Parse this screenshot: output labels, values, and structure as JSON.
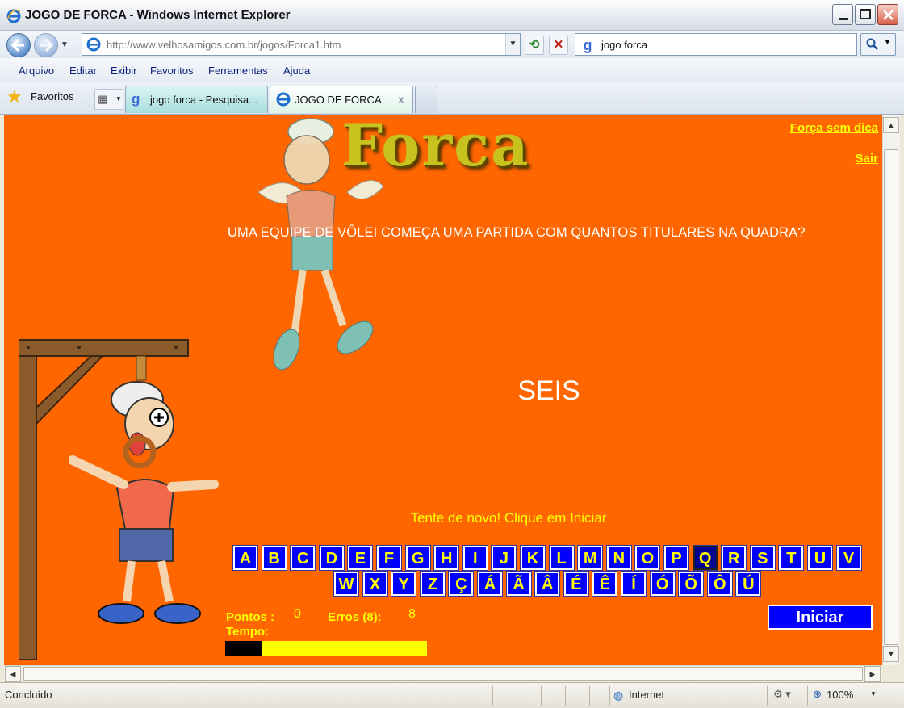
{
  "window": {
    "title": "JOGO DE FORCA - Windows Internet Explorer"
  },
  "address": {
    "url": "http://www.velhosamigos.com.br/jogos/Forca1.htm"
  },
  "search": {
    "value": "jogo forca"
  },
  "menu": {
    "items": [
      "Arquivo",
      "Editar",
      "Exibir",
      "Favoritos",
      "Ferramentas",
      "Ajuda"
    ]
  },
  "favorites": {
    "label": "Favoritos"
  },
  "tabs": [
    {
      "label": "jogo forca - Pesquisa...",
      "active": false
    },
    {
      "label": "JOGO DE FORCA",
      "active": true
    }
  ],
  "game": {
    "logo_text": "Forca",
    "link_no_hint": "Força sem dica",
    "link_exit": "Sair",
    "question": "UMA EQUIPE DE VÔLEI COMEÇA UMA PARTIDA COM QUANTOS TITULARES NA QUADRA?",
    "answer": "SEIS",
    "message": "Tente de novo! Clique em Iniciar",
    "keys_row1": [
      "A",
      "B",
      "C",
      "D",
      "E",
      "F",
      "G",
      "H",
      "I",
      "J",
      "K",
      "L",
      "M",
      "N",
      "O",
      "P",
      "Q",
      "R",
      "S",
      "T",
      "U",
      "V"
    ],
    "keys_row2": [
      "W",
      "X",
      "Y",
      "Z",
      "Ç",
      "Á",
      "Ã",
      "Â",
      "É",
      "Ê",
      "Í",
      "Ó",
      "Õ",
      "Ô",
      "Ú"
    ],
    "selected_key": "Q",
    "points_label": "Pontos :",
    "points_value": "0",
    "errors_label": "Erros (8):",
    "errors_value": "8",
    "time_label": "Tempo:",
    "time_remaining_fraction": 0.82,
    "start_button": "Iniciar"
  },
  "status": {
    "left": "Concluído",
    "zone": "Internet",
    "zoom": "100%"
  },
  "colors": {
    "background": "#ff6600",
    "key_bg": "#0000ff",
    "key_text": "#ffff00",
    "highlight": "#ffff00"
  }
}
